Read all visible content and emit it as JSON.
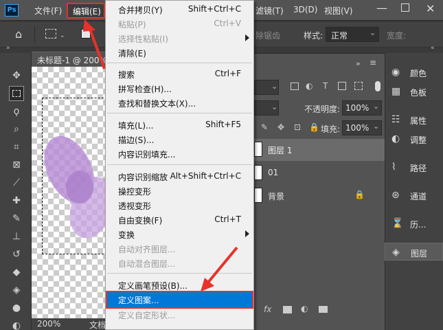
{
  "app_icon": "Ps",
  "menubar": {
    "file": "文件(F)",
    "edit": "编辑(E)",
    "filter": "滤镜(T)",
    "view3d": "3D(D)",
    "view": "视图(V)"
  },
  "options": {
    "antialias_label": "除锯齿",
    "style_label": "样式:",
    "style_value": "正常",
    "width_label": "宽度:"
  },
  "document": {
    "tab_title": "未标题-1 @ 200%",
    "zoom": "200%",
    "status_text": "文档"
  },
  "layers_panel": {
    "opacity_label": "不透明度:",
    "opacity_value": "100%",
    "fill_label": "填充:",
    "fill_value": "100%",
    "layers": [
      {
        "name": "图层 1"
      },
      {
        "name": "01"
      },
      {
        "name": "背景"
      }
    ]
  },
  "dock": {
    "items": [
      {
        "label": "颜色"
      },
      {
        "label": "色板"
      },
      {
        "label": "属性"
      },
      {
        "label": "调整"
      },
      {
        "label": "路径"
      },
      {
        "label": "通道"
      },
      {
        "label": "历..."
      },
      {
        "label": "图层"
      }
    ]
  },
  "edit_menu": {
    "items": [
      {
        "label": "合并拷贝(Y)",
        "shortcut": "Shift+Ctrl+C"
      },
      {
        "label": "粘贴(P)",
        "shortcut": "Ctrl+V"
      },
      {
        "label": "选择性粘贴(I)",
        "shortcut": ""
      },
      {
        "label": "清除(E)",
        "shortcut": ""
      },
      {
        "label": "搜索",
        "shortcut": "Ctrl+F"
      },
      {
        "label": "拼写检查(H)...",
        "shortcut": ""
      },
      {
        "label": "查找和替换文本(X)...",
        "shortcut": ""
      },
      {
        "label": "填充(L)...",
        "shortcut": "Shift+F5"
      },
      {
        "label": "描边(S)...",
        "shortcut": ""
      },
      {
        "label": "内容识别填充...",
        "shortcut": ""
      },
      {
        "label": "内容识别缩放",
        "shortcut": "Alt+Shift+Ctrl+C"
      },
      {
        "label": "操控变形",
        "shortcut": ""
      },
      {
        "label": "透视变形",
        "shortcut": ""
      },
      {
        "label": "自由变换(F)",
        "shortcut": "Ctrl+T"
      },
      {
        "label": "变换",
        "shortcut": ""
      },
      {
        "label": "自动对齐图层...",
        "shortcut": ""
      },
      {
        "label": "自动混合图层...",
        "shortcut": ""
      },
      {
        "label": "定义画笔预设(B)...",
        "shortcut": ""
      },
      {
        "label": "定义图案...",
        "shortcut": ""
      },
      {
        "label": "定义自定形状...",
        "shortcut": ""
      }
    ]
  },
  "colors": {
    "highlight": "#0078d7",
    "annotation": "#e8312b",
    "petal": "#b68bd6"
  }
}
